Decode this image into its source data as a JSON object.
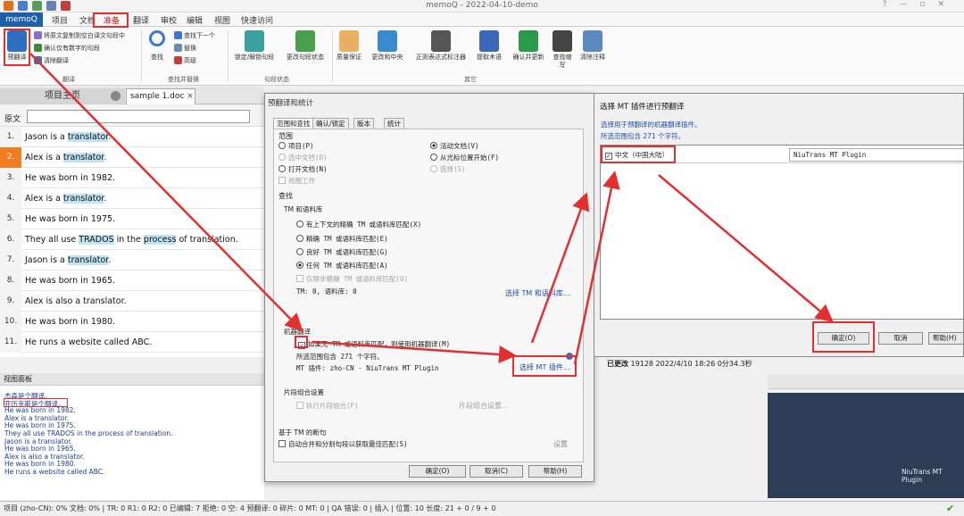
{
  "window": {
    "title": "memoQ - 2022-04-10-demo"
  },
  "menu": {
    "app": "memoQ",
    "items": [
      "项目",
      "文档",
      "准备",
      "翻译",
      "审校",
      "编辑",
      "视图",
      "快速访问"
    ]
  },
  "ribbon": {
    "pretranslate": "预翻译",
    "small1": "将原文复制到空白译文句段中",
    "small2": "确认仅有数字的句段",
    "small3": "清除翻译",
    "find": "查找",
    "find_next": "查找下一个",
    "replace": "替换",
    "advanced": "高级",
    "lock": "锁定/解锁句段",
    "change_status": "更改句段状态",
    "qa": "质量保证",
    "change_sync": "更改和中央",
    "regex": "正则表达式标注器",
    "extract": "提取术语",
    "confirm_update": "确认并更新",
    "find_abbr": "查找缩写",
    "clear_notes": "清除注释",
    "groups": [
      "翻译",
      "查找并替换",
      "句段状态",
      "其它"
    ]
  },
  "tabs": {
    "home": "项目主页",
    "doc": "sample 1.doc"
  },
  "source_label": "原文",
  "segments": [
    {
      "n": "1.",
      "pre": "Jason is a ",
      "hl": "translator",
      "post": "."
    },
    {
      "n": "2.",
      "pre": "Alex is a ",
      "hl": "translator",
      "post": "."
    },
    {
      "n": "3.",
      "pre": "He was born in 1982.",
      "hl": "",
      "post": ""
    },
    {
      "n": "4.",
      "pre": "Alex is a ",
      "hl": "translator",
      "post": "."
    },
    {
      "n": "5.",
      "pre": "He was born in 1975.",
      "hl": "",
      "post": ""
    },
    {
      "n": "6.",
      "pre": "They all use ",
      "hl": "TRADOS",
      "mid": " in the ",
      "hl2": "process",
      "post": " of translation."
    },
    {
      "n": "7.",
      "pre": "Jason is a ",
      "hl": "translator",
      "post": "."
    },
    {
      "n": "8.",
      "pre": "He was born in 1965.",
      "hl": "",
      "post": ""
    },
    {
      "n": "9.",
      "pre": "Alex is also a translator.",
      "hl": "",
      "post": ""
    },
    {
      "n": "10.",
      "pre": "He was born in 1980.",
      "hl": "",
      "post": ""
    },
    {
      "n": "11.",
      "pre": "He runs a website called ABC.",
      "hl": "",
      "post": ""
    }
  ],
  "view_panel": {
    "title": "视图面板",
    "lines": [
      "杰森是个翻译。",
      "亚历克斯是个翻译。",
      "He was born in 1982.",
      "Alex is a translator.",
      "He was born in 1975.",
      "They all use TRADOS in the process of translation.",
      "Jason is a translator.",
      "He was born in 1965.",
      "Alex is also a translator.",
      "He was born in 1980.",
      "He runs a website called ABC."
    ]
  },
  "right_info": {
    "changed": "已更改",
    "value": "19128 2022/4/10 18:26",
    "time": "0分34.3秒"
  },
  "right_strip_label": "NiuTrans MT Plugin",
  "dialog": {
    "title": "预翻译和统计",
    "tabs": [
      "范围和查找",
      "确认/锁定",
      "版本",
      "统计"
    ],
    "scope": "范围",
    "opt_project": "项目(P)",
    "opt_selected": "选中文档(D)",
    "opt_open": "打开文档(N)",
    "opt_view": "视图工作",
    "opt_active": "活动文档(V)",
    "opt_cursor": "从光标位置开始(F)",
    "opt_selection": "选择(S)",
    "lookup": "查找",
    "tm_tb": "TM 和语料库",
    "m1": "有上下文的精确 TM 或语料库匹配(X)",
    "m2": "精确 TM 或语料库匹配(E)",
    "m3": "良好 TM 或语料库匹配(G)",
    "m4": "任何 TM 或语料库匹配(A)",
    "m5": "仅限非模糊 TM 或语料库匹配(U)",
    "tm_count": "TM: 0, 语料库: 0",
    "select_tm": "选择 TM 和语料库...",
    "mt_section": "机器翻译",
    "mt_check": "如果无 TM 或语料库匹配，则使用机器翻译(M)",
    "mt_range": "所选范围包含 271 个字符。",
    "mt_plugin": "MT 插件: zho-CN - NiuTrans MT Plugin",
    "select_mt": "选择 MT 插件...",
    "fragment": "片段组合设置",
    "exec_frag": "执行片段组合(F)",
    "frag_settings": "片段组合设置...",
    "tm_based": "基于 TM 的断句",
    "auto_merge": "自动合并和分割句段以获取最佳匹配(S)",
    "settings": "设置",
    "ok": "确定(O)",
    "cancel": "取消(C)",
    "help": "帮助(H)"
  },
  "dialog2": {
    "title": "选择 MT 插件进行预翻译",
    "desc1": "选择用于预翻译的机器翻译插件。",
    "desc2": "所选范围包含 271 个字符。",
    "lang": "中文（中国大陆）",
    "plugin": "NiuTrans MT Plugin",
    "ok": "确定(O)",
    "cancel": "取消",
    "help": "帮助(H)"
  },
  "status": "项目 (zho-CN): 0%  文档: 0%  |  TR: 0   R1: 0   R2: 0   已编辑: 7   拒绝: 0   空: 4   预翻译: 0   碎片: 0   MT: 0  |  QA 错误: 0  |  插入  |  位置: 10   长度: 21 + 0 / 9 + 0",
  "colors": {
    "accent": "#1d5fa8",
    "highlight_border": "#e03030",
    "active_row": "#f07d22"
  }
}
